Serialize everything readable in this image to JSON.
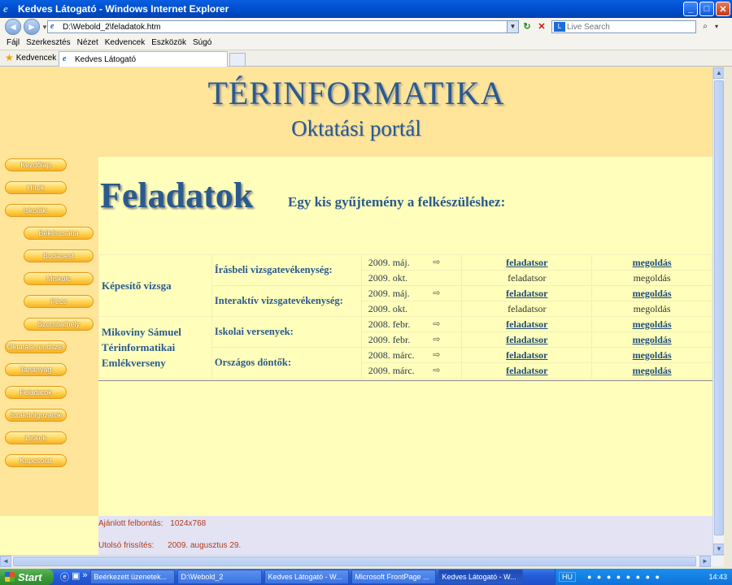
{
  "window": {
    "title": "Kedves Látogató - Windows Internet Explorer",
    "app_icon": "ie-icon",
    "buttons": {
      "minimize": "_",
      "maximize": "□",
      "close": "✕"
    }
  },
  "addressbar": {
    "back": "◄",
    "forward": "►",
    "url": "D:\\Webold_2\\feladatok.htm",
    "search_placeholder": "Live Search"
  },
  "menu": [
    "Fájl",
    "Szerkesztés",
    "Nézet",
    "Kedvencek",
    "Eszközök",
    "Súgó"
  ],
  "favorites": {
    "label": "Kedvencek",
    "tab_title": "Kedves Látogató"
  },
  "banner": {
    "title": "TÉRINFORMATIKA",
    "subtitle": "Oktatási portál"
  },
  "nav": {
    "items": [
      "Kezdőlap",
      "Hírek",
      "Iskolák:",
      "Békéscsaba",
      "Budapest",
      "Miskolc",
      "Pécs",
      "Szombathely",
      "Oktatási rendszer",
      "Tananyag",
      "Feladatok",
      "Szakdolgozatok",
      "Linkek",
      "Kapcsolat"
    ]
  },
  "main": {
    "title": "Feladatok",
    "subtitle": "Egy kis gyűjtemény a felkészüléshez:",
    "groups": [
      {
        "name": "Képesítő vizsga",
        "exams": [
          {
            "name": "Írásbeli vizsgatevékenység:",
            "rows": [
              {
                "date": "2009. máj.",
                "arrow": true,
                "task": "feladatsor",
                "task_link": true,
                "solution": "megoldás",
                "solution_link": true
              },
              {
                "date": "2009. okt.",
                "arrow": false,
                "task": "feladatsor",
                "task_link": false,
                "solution": "megoldás",
                "solution_link": false
              }
            ]
          },
          {
            "name": "Interaktív vizsgatevékenység:",
            "rows": [
              {
                "date": "2009. máj.",
                "arrow": true,
                "task": "feladatsor",
                "task_link": true,
                "solution": "megoldás",
                "solution_link": true
              },
              {
                "date": "2009. okt.",
                "arrow": false,
                "task": "feladatsor",
                "task_link": false,
                "solution": "megoldás",
                "solution_link": false
              }
            ]
          }
        ]
      },
      {
        "name": "Mikoviny Sámuel Térinformatikai Emlékverseny",
        "exams": [
          {
            "name": "Iskolai versenyek:",
            "rows": [
              {
                "date": "2008. febr.",
                "arrow": true,
                "task": "feladatsor",
                "task_link": true,
                "solution": "megoldás",
                "solution_link": true
              },
              {
                "date": "2009. febr.",
                "arrow": true,
                "task": "feladatsor",
                "task_link": true,
                "solution": "megoldás",
                "solution_link": true
              }
            ]
          },
          {
            "name": "Országos döntők:",
            "rows": [
              {
                "date": "2008. márc.",
                "arrow": true,
                "task": "feladatsor",
                "task_link": true,
                "solution": "megoldás",
                "solution_link": true
              },
              {
                "date": "2009. márc.",
                "arrow": true,
                "task": "feladatsor",
                "task_link": true,
                "solution": "megoldás",
                "solution_link": true
              }
            ]
          }
        ]
      }
    ]
  },
  "footer": {
    "resolution_label": "Ajánlott felbontás:",
    "resolution_value": "1024x768",
    "updated_label": "Utolsó frissítés:",
    "updated_value": "2009. augusztus 29."
  },
  "taskbar": {
    "start": "Start",
    "buttons": [
      "Beérkezett üzenetek...",
      "D:\\Webold_2",
      "Kedves Látogató - W...",
      "Microsoft FrontPage ...",
      "Kedves Látogató - W..."
    ],
    "active_index": 4,
    "lang": "HU",
    "clock": "14:43"
  }
}
